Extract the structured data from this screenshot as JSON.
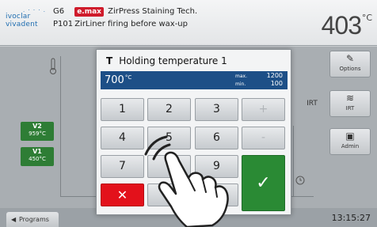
{
  "header": {
    "logo_line1": "ivoclar",
    "logo_line2": "vivadent",
    "program_code": "G6",
    "emax_badge": "e.max",
    "program_name": "ZirPress Staining Tech.",
    "sub_code": "P101",
    "sub_name": "ZirLiner firing before wax-up",
    "temperature": "403",
    "temperature_unit": "°C"
  },
  "side_buttons": {
    "options": "Options",
    "irt_btn": "IRT",
    "irt_text": "IRT",
    "admin": "Admin"
  },
  "v_buttons": [
    {
      "name": "V2",
      "value": "959°C"
    },
    {
      "name": "V1",
      "value": "450°C"
    }
  ],
  "dialog": {
    "title_symbol": "T",
    "title": "Holding temperature 1",
    "value": "700",
    "value_unit": "°C",
    "max_label": "max.",
    "max_value": "1200",
    "min_label": "min.",
    "min_value": "100",
    "keys": {
      "k1": "1",
      "k2": "2",
      "k3": "3",
      "plus": "+",
      "k4": "4",
      "k5": "5",
      "k6": "6",
      "minus": "-",
      "k7": "7",
      "k9": "9",
      "cancel": "✕",
      "ok": "✓"
    }
  },
  "footer": {
    "programs": "Programs",
    "time": "13:15:27"
  },
  "colors": {
    "accent_blue": "#1d4f87",
    "ok_green": "#2a8a34",
    "cancel_red": "#e3111b",
    "emax_red": "#cf1b2b"
  }
}
